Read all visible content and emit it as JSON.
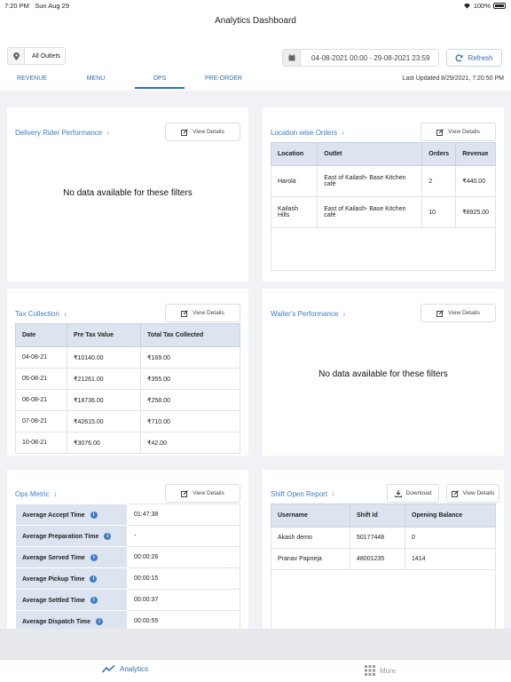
{
  "status": {
    "time": "7:20 PM",
    "date": "Sun Aug 29",
    "battery": "100%"
  },
  "header": {
    "title": "Analytics Dashboard"
  },
  "controls": {
    "outlet_label": "All Outlets",
    "date_range": "04-08-2021 00:00 - 29-08-2021 23:59",
    "refresh_label": "Refresh",
    "last_updated": "Last Updated 8/29/2021, 7:20:50 PM"
  },
  "tabs": [
    {
      "label": "REVENUE",
      "active": false
    },
    {
      "label": "MENU",
      "active": false
    },
    {
      "label": "OPS",
      "active": true
    },
    {
      "label": "PRE-ORDER",
      "active": false
    }
  ],
  "common": {
    "view_details": "View Details",
    "download": "Download",
    "info": "i"
  },
  "delivery_rider": {
    "title": "Delivery Rider Performance",
    "empty": "No data available for these filters"
  },
  "location_orders": {
    "title": "Location wise Orders",
    "headers": [
      "Location",
      "Outlet",
      "Orders",
      "Revenue"
    ],
    "rows": [
      [
        "Harola",
        "East of Kailash- Base Kitchen café",
        "2",
        "₹440.00"
      ],
      [
        "Kailash Hills",
        "East of Kailash- Base Kitchen café",
        "10",
        "₹8925.00"
      ]
    ]
  },
  "tax_collection": {
    "title": "Tax Collection",
    "headers": [
      "Date",
      "Pre Tax Value",
      "Total Tax Collected"
    ],
    "rows": [
      [
        "04-08-21",
        "₹10140.00",
        "₹169.00"
      ],
      [
        "05-08-21",
        "₹21261.00",
        "₹355.00"
      ],
      [
        "06-08-21",
        "₹18736.00",
        "₹258.00"
      ],
      [
        "07-08-21",
        "₹42615.00",
        "₹710.00"
      ],
      [
        "10-08-21",
        "₹3076.00",
        "₹42.00"
      ]
    ]
  },
  "waiter_performance": {
    "title": "Waiter's Performance",
    "empty": "No data available for these filters"
  },
  "ops_metric": {
    "title": "Ops Metric",
    "rows": [
      [
        "Average Accept Time",
        "01:47:38"
      ],
      [
        "Average Preparation Time",
        "-"
      ],
      [
        "Average Served Time",
        "00:00:26"
      ],
      [
        "Average Pickup Time",
        "00:00:15"
      ],
      [
        "Average Settled Time",
        "00:00:37"
      ],
      [
        "Average Dispatch Time",
        "00:00:55"
      ]
    ]
  },
  "shift_report": {
    "title": "Shift Open Report",
    "headers": [
      "Username",
      "Shift Id",
      "Opening Balance"
    ],
    "rows": [
      [
        "Akash demo",
        "50177448",
        "0"
      ],
      [
        "Pranav Papneja",
        "48001235",
        "1414"
      ]
    ]
  },
  "bottom_nav": {
    "analytics": "Analytics",
    "more": "More"
  },
  "colors": {
    "accent": "#2f6fb3",
    "table_header": "#dbe4ef",
    "background": "#f0f2f5"
  }
}
